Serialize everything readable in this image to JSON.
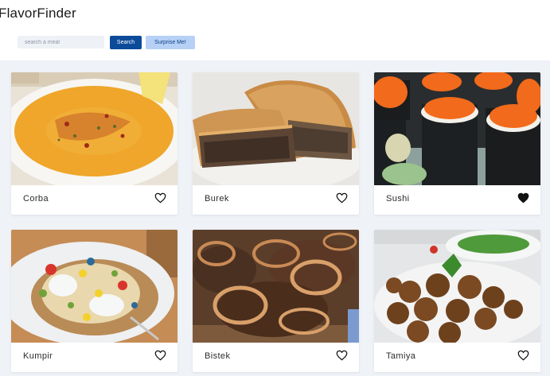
{
  "header": {
    "title": "FlavorFinder",
    "search_placeholder": "search a meal",
    "search_value": "",
    "search_button": "Search",
    "surprise_button": "Surprise Me!"
  },
  "meals": [
    {
      "name": "Corba",
      "favorite": false
    },
    {
      "name": "Burek",
      "favorite": false
    },
    {
      "name": "Sushi",
      "favorite": true
    },
    {
      "name": "Kumpir",
      "favorite": false
    },
    {
      "name": "Bistek",
      "favorite": false
    },
    {
      "name": "Tamiya",
      "favorite": false
    }
  ],
  "icons": {
    "favorite": "heart-icon"
  },
  "colors": {
    "primary": "#0c4b9a",
    "secondary": "#b7d1f6",
    "background": "#eff2f7"
  }
}
